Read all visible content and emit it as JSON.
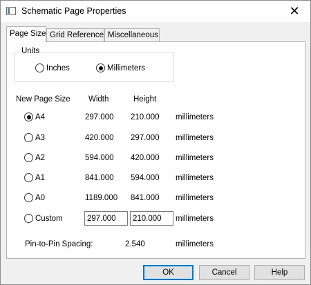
{
  "window": {
    "title": "Schematic Page Properties",
    "close_glyph": "✕"
  },
  "tabs": [
    {
      "label": "Page Size",
      "active": true
    },
    {
      "label": "Grid Reference",
      "active": false
    },
    {
      "label": "Miscellaneous",
      "active": false
    }
  ],
  "units": {
    "group_label": "Units",
    "options": [
      {
        "label": "Inches",
        "checked": false
      },
      {
        "label": "Millimeters",
        "checked": true
      }
    ]
  },
  "columns": {
    "new_page_size": "New Page Size",
    "width": "Width",
    "height": "Height"
  },
  "sizes": [
    {
      "label": "A4",
      "width": "297.000",
      "height": "210.000",
      "unit": "millimeters",
      "checked": true
    },
    {
      "label": "A3",
      "width": "420.000",
      "height": "297.000",
      "unit": "millimeters",
      "checked": false
    },
    {
      "label": "A2",
      "width": "594.000",
      "height": "420.000",
      "unit": "millimeters",
      "checked": false
    },
    {
      "label": "A1",
      "width": "841.000",
      "height": "594.000",
      "unit": "millimeters",
      "checked": false
    },
    {
      "label": "A0",
      "width": "1189.000",
      "height": "841.000",
      "unit": "millimeters",
      "checked": false
    }
  ],
  "custom": {
    "label": "Custom",
    "width_value": "297.000",
    "height_value": "210.000",
    "unit": "millimeters",
    "checked": false
  },
  "spacing": {
    "label": "Pin-to-Pin Spacing:",
    "value": "2.540",
    "unit": "millimeters"
  },
  "buttons": {
    "ok": "OK",
    "cancel": "Cancel",
    "help": "Help"
  },
  "colors": {
    "accent": "#0078d7",
    "dialog_bg": "#f0f0f0",
    "panel_bg": "#ffffff"
  }
}
